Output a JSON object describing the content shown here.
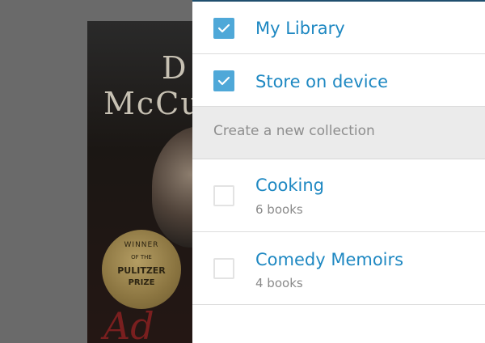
{
  "cover": {
    "author_line1": "D",
    "author_line2": "McCu",
    "seal_top": "WINNER",
    "seal_mid": "OF THE",
    "seal_big": "PULITZER",
    "seal_bot": "PRIZE",
    "script": "Ad"
  },
  "panel": {
    "items": [
      {
        "label": "My Library",
        "checked": true
      },
      {
        "label": "Store on device",
        "checked": true
      }
    ],
    "create_label": "Create a new collection",
    "collections": [
      {
        "label": "Cooking",
        "count": "6 books",
        "checked": false
      },
      {
        "label": "Comedy Memoirs",
        "count": "4 books",
        "checked": false
      }
    ]
  },
  "colors": {
    "accent": "#1e88c2",
    "checkbox_fill": "#4fa8d8",
    "overlay": "#6a6a6a"
  }
}
